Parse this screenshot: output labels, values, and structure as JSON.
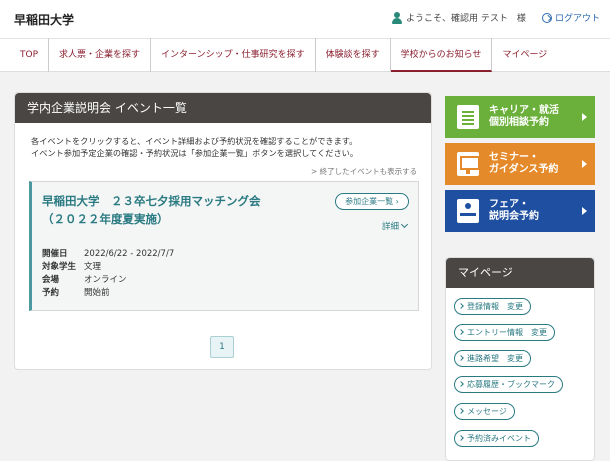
{
  "header": {
    "logo": "早稲田大学",
    "user_greeting": "ようこそ、確認用 テスト　様",
    "logout_label": "ログアウト"
  },
  "nav": {
    "items": [
      {
        "label": "TOP"
      },
      {
        "label": "求人票・企業を探す"
      },
      {
        "label": "インターンシップ・仕事研究を探す"
      },
      {
        "label": "体験談を探す"
      },
      {
        "label": "学校からのお知らせ"
      },
      {
        "label": "マイページ"
      }
    ],
    "active_index": 4
  },
  "panel": {
    "title": "学内企業説明会 イベント一覧",
    "intro_line1": "各イベントをクリックすると、イベント詳細および予約状況を確認することができます。",
    "intro_line2": "イベント参加予定企業の確認・予約状況は「参加企業一覧」ボタンを選択してください。",
    "past_link": "> 終了したイベントも表示する"
  },
  "event": {
    "title_line1": "早稲田大学　２３卒七夕採用マッチング会",
    "title_line2": "（２０２２年度夏実施）",
    "company_list_button": "参加企業一覧",
    "detail_label": "詳細",
    "info": [
      {
        "label": "開催日",
        "value": "2022/6/22 - 2022/7/7"
      },
      {
        "label": "対象学生",
        "value": "文理"
      },
      {
        "label": "会場",
        "value": "オンライン"
      },
      {
        "label": "予約",
        "value": "開始前"
      }
    ]
  },
  "pagination": {
    "current_page": "1"
  },
  "side_buttons": [
    {
      "line1": "キャリア・就活",
      "line2": "個別相談予約",
      "icon": "document-icon",
      "color": "#6ab03a"
    },
    {
      "line1": "セミナー・",
      "line2": "ガイダンス予約",
      "icon": "presentation-icon",
      "color": "#e58a2a"
    },
    {
      "line1": "フェア・",
      "line2": "説明会予約",
      "icon": "desk-icon",
      "color": "#1e4fa0"
    }
  ],
  "mypage": {
    "title": "マイページ",
    "links": [
      {
        "label": "登録情報　変更"
      },
      {
        "label": "エントリー情報　変更"
      },
      {
        "label": "進路希望　変更"
      },
      {
        "label": "応募履歴・ブックマーク"
      },
      {
        "label": "メッセージ"
      },
      {
        "label": "予約済みイベント"
      }
    ]
  }
}
